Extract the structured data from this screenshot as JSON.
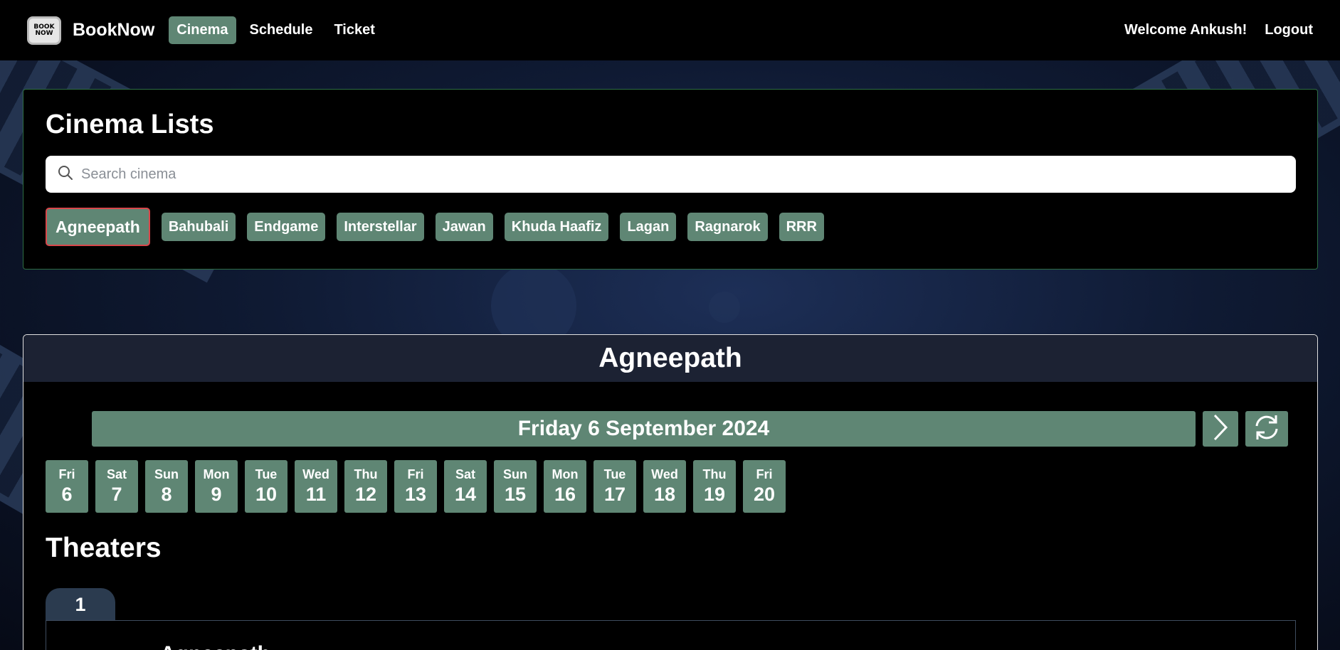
{
  "brand": {
    "logo_text_top": "BOOK",
    "logo_text_bottom": "NOW",
    "name": "BookNow"
  },
  "nav": {
    "links": [
      {
        "label": "Cinema",
        "active": true
      },
      {
        "label": "Schedule",
        "active": false
      },
      {
        "label": "Ticket",
        "active": false
      }
    ],
    "welcome": "Welcome Ankush!",
    "logout": "Logout"
  },
  "cinema_list": {
    "title": "Cinema Lists",
    "search_placeholder": "Search cinema",
    "cinemas": [
      "Agneepath",
      "Bahubali",
      "Endgame",
      "Interstellar",
      "Jawan",
      "Khuda Haafiz",
      "Lagan",
      "Ragnarok",
      "RRR"
    ],
    "selected": "Agneepath"
  },
  "detail": {
    "title": "Agneepath",
    "current_date": "Friday 6 September 2024",
    "days": [
      {
        "name": "Fri",
        "num": "6"
      },
      {
        "name": "Sat",
        "num": "7"
      },
      {
        "name": "Sun",
        "num": "8"
      },
      {
        "name": "Mon",
        "num": "9"
      },
      {
        "name": "Tue",
        "num": "10"
      },
      {
        "name": "Wed",
        "num": "11"
      },
      {
        "name": "Thu",
        "num": "12"
      },
      {
        "name": "Fri",
        "num": "13"
      },
      {
        "name": "Sat",
        "num": "14"
      },
      {
        "name": "Sun",
        "num": "15"
      },
      {
        "name": "Mon",
        "num": "16"
      },
      {
        "name": "Tue",
        "num": "17"
      },
      {
        "name": "Wed",
        "num": "18"
      },
      {
        "name": "Thu",
        "num": "19"
      },
      {
        "name": "Fri",
        "num": "20"
      }
    ],
    "theaters_title": "Theaters",
    "theater_tab": "1",
    "theater_movie": "Agneepath"
  },
  "colors": {
    "accent": "#5f8674",
    "selected_border": "#d9474b",
    "panel_border": "#2e6e44"
  },
  "icons": {
    "search": "search-icon",
    "next": "chevron-right-icon",
    "refresh": "refresh-icon"
  }
}
